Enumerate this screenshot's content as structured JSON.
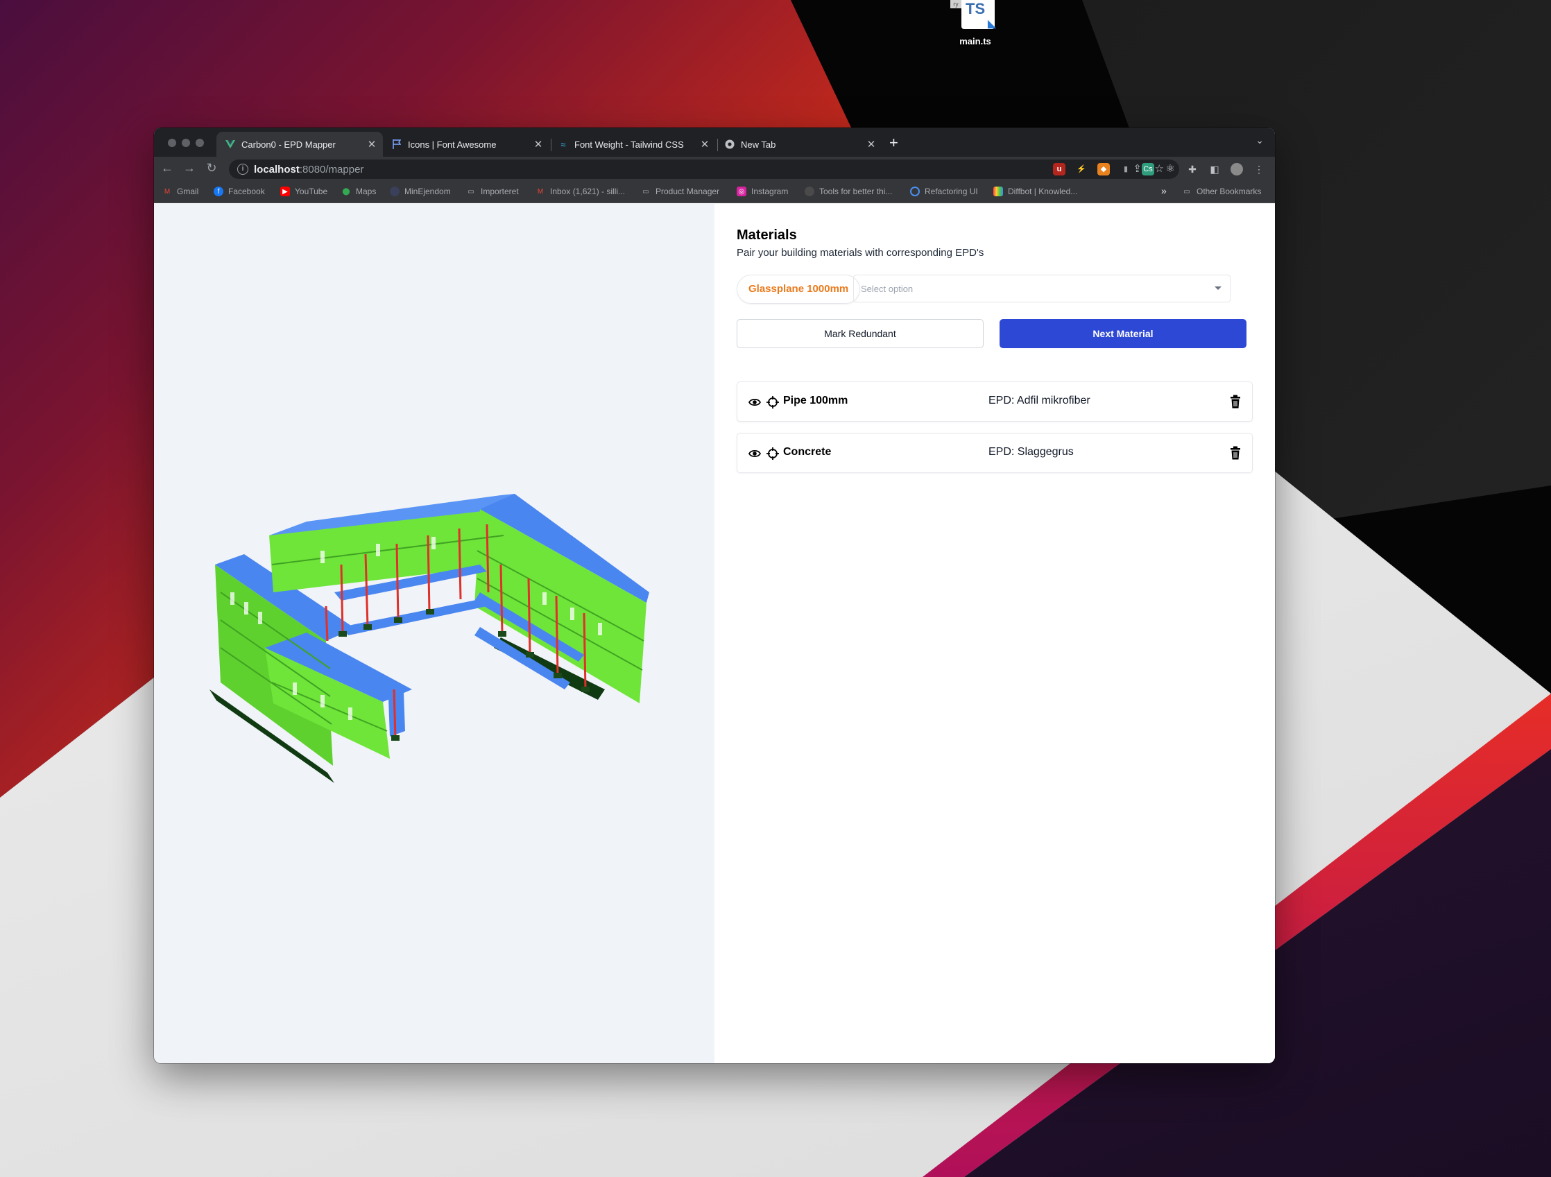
{
  "desktop": {
    "file_name": "main.ts",
    "file_badge": "TS"
  },
  "browser": {
    "tabs": [
      {
        "title": "Carbon0 - EPD Mapper",
        "active": true
      },
      {
        "title": "Icons | Font Awesome",
        "active": false
      },
      {
        "title": "Font Weight - Tailwind CSS",
        "active": false
      },
      {
        "title": "New Tab",
        "active": false
      }
    ],
    "url_host": "localhost",
    "url_rest": ":8080/mapper",
    "bookmarks": [
      "Gmail",
      "Facebook",
      "YouTube",
      "Maps",
      "MinEjendom",
      "Importeret",
      "Inbox (1,621) - silli...",
      "Product Manager",
      "Instagram",
      "Tools for better thi...",
      "Refactoring UI",
      "Diffbot | Knowled..."
    ],
    "overflow_label": "»",
    "other_bookmarks": "Other Bookmarks"
  },
  "panel": {
    "title": "Materials",
    "subtitle": "Pair your building materials with corresponding EPD's",
    "current_material": "Glassplane 1000mm",
    "select_placeholder": "Select option",
    "mark_redundant_label": "Mark Redundant",
    "next_material_label": "Next Material",
    "pairs": [
      {
        "material": "Pipe 100mm",
        "epd": "EPD: Adfil mikrofiber"
      },
      {
        "material": "Concrete",
        "epd": "EPD: Slaggegrus"
      }
    ]
  },
  "colors": {
    "accent_orange": "#ea7a1c",
    "primary_blue": "#2e48d6",
    "model_walls": "#6fe53a",
    "model_roof": "#4a86f0",
    "model_columns": "#e0302a"
  }
}
